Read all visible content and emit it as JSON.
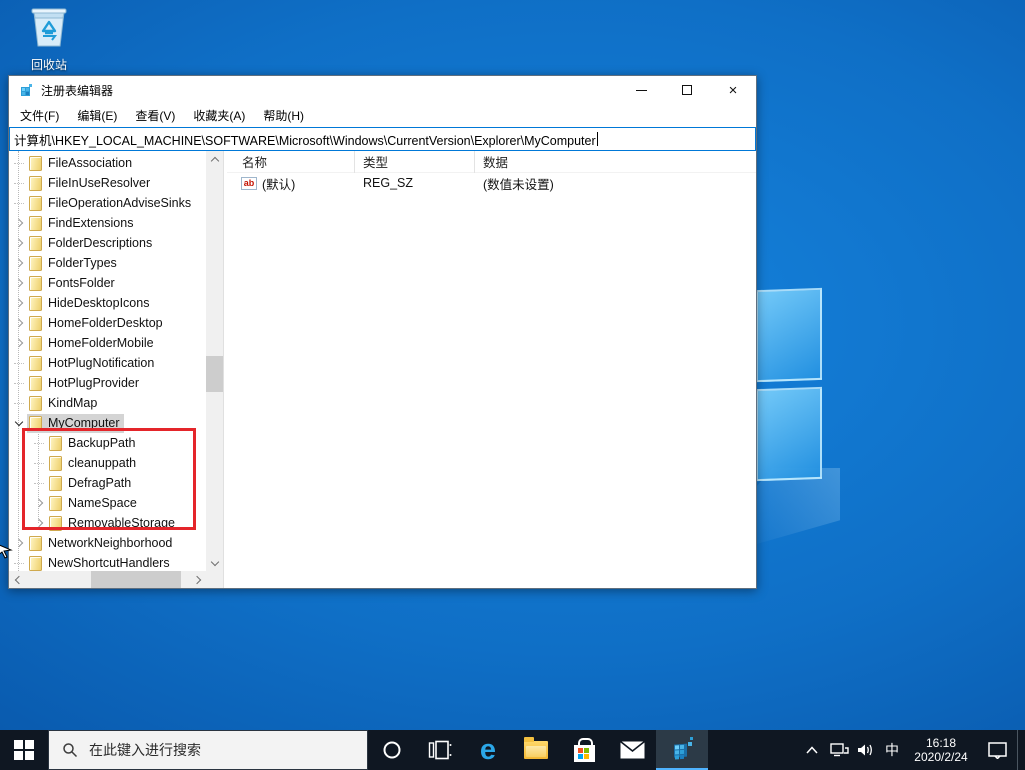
{
  "desktop": {
    "recycle_bin_label": "回收站"
  },
  "window": {
    "title": "注册表编辑器",
    "menu": [
      "文件(F)",
      "编辑(E)",
      "查看(V)",
      "收藏夹(A)",
      "帮助(H)"
    ],
    "address": "计算机\\HKEY_LOCAL_MACHINE\\SOFTWARE\\Microsoft\\Windows\\CurrentVersion\\Explorer\\MyComputer",
    "tree": {
      "items": [
        {
          "label": "FileAssociation",
          "level": 0,
          "expander": "none"
        },
        {
          "label": "FileInUseResolver",
          "level": 0,
          "expander": "none"
        },
        {
          "label": "FileOperationAdviseSinks",
          "level": 0,
          "expander": "none"
        },
        {
          "label": "FindExtensions",
          "level": 0,
          "expander": "collapsed"
        },
        {
          "label": "FolderDescriptions",
          "level": 0,
          "expander": "collapsed"
        },
        {
          "label": "FolderTypes",
          "level": 0,
          "expander": "collapsed"
        },
        {
          "label": "FontsFolder",
          "level": 0,
          "expander": "collapsed"
        },
        {
          "label": "HideDesktopIcons",
          "level": 0,
          "expander": "collapsed"
        },
        {
          "label": "HomeFolderDesktop",
          "level": 0,
          "expander": "collapsed"
        },
        {
          "label": "HomeFolderMobile",
          "level": 0,
          "expander": "collapsed"
        },
        {
          "label": "HotPlugNotification",
          "level": 0,
          "expander": "none"
        },
        {
          "label": "HotPlugProvider",
          "level": 0,
          "expander": "none"
        },
        {
          "label": "KindMap",
          "level": 0,
          "expander": "none"
        },
        {
          "label": "MyComputer",
          "level": 0,
          "expander": "expanded",
          "selected": true
        },
        {
          "label": "BackupPath",
          "level": 1,
          "expander": "none"
        },
        {
          "label": "cleanuppath",
          "level": 1,
          "expander": "none"
        },
        {
          "label": "DefragPath",
          "level": 1,
          "expander": "none"
        },
        {
          "label": "NameSpace",
          "level": 1,
          "expander": "collapsed"
        },
        {
          "label": "RemovableStorage",
          "level": 1,
          "expander": "collapsed"
        },
        {
          "label": "NetworkNeighborhood",
          "level": 0,
          "expander": "collapsed"
        },
        {
          "label": "NewShortcutHandlers",
          "level": 0,
          "expander": "none"
        }
      ]
    },
    "list": {
      "columns": [
        "名称",
        "类型",
        "数据"
      ],
      "rows": [
        {
          "name": "(默认)",
          "type": "REG_SZ",
          "data": "(数值未设置)",
          "icon": "string-value-icon",
          "icon_text": "ab"
        }
      ]
    }
  },
  "taskbar": {
    "search_placeholder": "在此键入进行搜索",
    "ime_indicator": "中",
    "clock": {
      "time": "16:18",
      "date": "2020/2/24"
    }
  },
  "colors": {
    "accent": "#0078d7",
    "highlight_red_box": "#e4252a",
    "selection_gray": "#d4d4d4",
    "taskbar_bg": "#0f1722",
    "active_app_underline": "#4fb3ff",
    "desktop_blue": "#0f6fc6"
  }
}
